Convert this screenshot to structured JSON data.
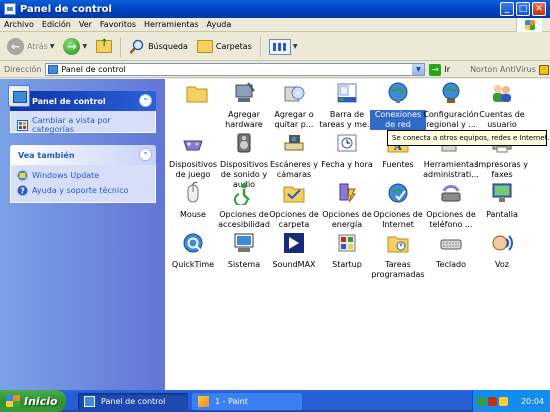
{
  "window": {
    "title": "Panel de control"
  },
  "menu": [
    "Archivo",
    "Edición",
    "Ver",
    "Favoritos",
    "Herramientas",
    "Ayuda"
  ],
  "toolbar": {
    "back": "Atrás",
    "search": "Búsqueda",
    "folders": "Carpetas"
  },
  "address": {
    "label": "Dirección",
    "value": "Panel de control",
    "go": "Ir",
    "norton": "Norton AntiVirus"
  },
  "sidebar": {
    "control_panel": {
      "title": "Panel de control",
      "link": "Cambiar a vista por categorías"
    },
    "see_also": {
      "title": "Vea también",
      "links": [
        "Windows Update",
        "Ayuda y soporte técnico"
      ]
    }
  },
  "items": [
    {
      "label": "",
      "icon": "folder-icon"
    },
    {
      "label": "Agregar hardware",
      "icon": "add-hardware-icon"
    },
    {
      "label": "Agregar o quitar p...",
      "icon": "add-remove-programs-icon"
    },
    {
      "label": "Barra de tareas y me...",
      "icon": "taskbar-icon"
    },
    {
      "label": "Conexiones de red",
      "icon": "network-connections-icon"
    },
    {
      "label": "Configuración regional y ...",
      "icon": "regional-settings-icon"
    },
    {
      "label": "Cuentas de usuario",
      "icon": "user-accounts-icon"
    },
    {
      "label": "Dispositivos de juego",
      "icon": "game-controller-icon"
    },
    {
      "label": "Dispositivos de sonido y audio",
      "icon": "speaker-icon"
    },
    {
      "label": "Escáneres y cámaras",
      "icon": "scanner-camera-icon"
    },
    {
      "label": "Fecha y hora",
      "icon": "clock-icon"
    },
    {
      "label": "Fuentes",
      "icon": "fonts-folder-icon"
    },
    {
      "label": "Herramientas administrati...",
      "icon": "admin-tools-icon"
    },
    {
      "label": "Impresoras y faxes",
      "icon": "printer-icon"
    },
    {
      "label": "Mouse",
      "icon": "mouse-icon"
    },
    {
      "label": "Opciones de accesibilidad",
      "icon": "accessibility-icon"
    },
    {
      "label": "Opciones de carpeta",
      "icon": "folder-options-icon"
    },
    {
      "label": "Opciones de energía",
      "icon": "power-options-icon"
    },
    {
      "label": "Opciones de Internet",
      "icon": "internet-options-icon"
    },
    {
      "label": "Opciones de teléfono ...",
      "icon": "phone-modem-icon"
    },
    {
      "label": "Pantalla",
      "icon": "display-icon"
    },
    {
      "label": "QuickTime",
      "icon": "quicktime-icon"
    },
    {
      "label": "Sistema",
      "icon": "system-icon"
    },
    {
      "label": "SoundMAX",
      "icon": "soundmax-icon"
    },
    {
      "label": "Startup",
      "icon": "startup-icon"
    },
    {
      "label": "Tareas programadas",
      "icon": "scheduled-tasks-icon"
    },
    {
      "label": "Teclado",
      "icon": "keyboard-icon"
    },
    {
      "label": "Voz",
      "icon": "speech-icon"
    }
  ],
  "tooltip": "Se conecta a otros equipos, redes e Internet.",
  "taskbar": {
    "start": "Inicio",
    "tasks": [
      "Panel de control",
      "1 - Paint"
    ],
    "clock": "20:04"
  },
  "colors": {
    "selection": "#316ac5",
    "sidebar_link": "#215dc6",
    "taskbar": "#245edb",
    "start": "#3a9a3a"
  }
}
